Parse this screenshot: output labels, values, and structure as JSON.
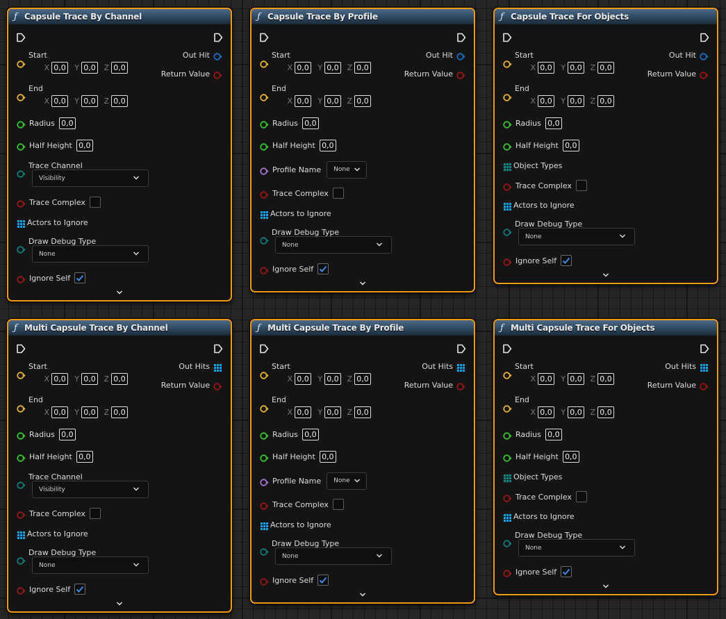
{
  "colors": {
    "accent": "#f09a17",
    "vector_pin": "#e8b332",
    "float_pin": "#36c436",
    "struct_pin": "#0b8d8d",
    "bool_pin": "#9b1515",
    "object_array_pin": "#12a4e8",
    "name_pin": "#a571d1",
    "hit_pin": "#1a6ec5"
  },
  "nodes": [
    {
      "title": "Capsule Trace By Channel",
      "outputs": {
        "hit": "Out Hit",
        "ret": "Return Value"
      },
      "start": "Start",
      "end": "End",
      "axes": {
        "x": "X",
        "y": "Y",
        "z": "Z"
      },
      "start_values": {
        "x": "0,0",
        "y": "0,0",
        "z": "0,0"
      },
      "end_values": {
        "x": "0,0",
        "y": "0,0",
        "z": "0,0"
      },
      "radius": {
        "label": "Radius",
        "value": "0,0"
      },
      "half_height": {
        "label": "Half Height",
        "value": "0,0"
      },
      "trace_channel": {
        "label": "Trace Channel",
        "value": "Visibility"
      },
      "trace_complex": {
        "label": "Trace Complex",
        "checked": false
      },
      "actors_to_ignore": "Actors to Ignore",
      "draw_debug": {
        "label": "Draw Debug Type",
        "value": "None"
      },
      "ignore_self": {
        "label": "Ignore Self",
        "checked": true
      }
    },
    {
      "title": "Capsule Trace By Profile",
      "outputs": {
        "hit": "Out Hit",
        "ret": "Return Value"
      },
      "start": "Start",
      "end": "End",
      "axes": {
        "x": "X",
        "y": "Y",
        "z": "Z"
      },
      "start_values": {
        "x": "0,0",
        "y": "0,0",
        "z": "0,0"
      },
      "end_values": {
        "x": "0,0",
        "y": "0,0",
        "z": "0,0"
      },
      "radius": {
        "label": "Radius",
        "value": "0,0"
      },
      "half_height": {
        "label": "Half Height",
        "value": "0,0"
      },
      "profile_name": {
        "label": "Profile Name",
        "value": "None"
      },
      "trace_complex": {
        "label": "Trace Complex",
        "checked": false
      },
      "actors_to_ignore": "Actors to Ignore",
      "draw_debug": {
        "label": "Draw Debug Type",
        "value": "None"
      },
      "ignore_self": {
        "label": "Ignore Self",
        "checked": true
      }
    },
    {
      "title": "Capsule Trace For Objects",
      "outputs": {
        "hit": "Out Hit",
        "ret": "Return Value"
      },
      "start": "Start",
      "end": "End",
      "axes": {
        "x": "X",
        "y": "Y",
        "z": "Z"
      },
      "start_values": {
        "x": "0,0",
        "y": "0,0",
        "z": "0,0"
      },
      "end_values": {
        "x": "0,0",
        "y": "0,0",
        "z": "0,0"
      },
      "radius": {
        "label": "Radius",
        "value": "0,0"
      },
      "half_height": {
        "label": "Half Height",
        "value": "0,0"
      },
      "object_types": "Object Types",
      "trace_complex": {
        "label": "Trace Complex",
        "checked": false
      },
      "actors_to_ignore": "Actors to Ignore",
      "draw_debug": {
        "label": "Draw Debug Type",
        "value": "None"
      },
      "ignore_self": {
        "label": "Ignore Self",
        "checked": true
      }
    },
    {
      "title": "Multi Capsule Trace By Channel",
      "outputs": {
        "hit": "Out Hits",
        "ret": "Return Value"
      },
      "start": "Start",
      "end": "End",
      "axes": {
        "x": "X",
        "y": "Y",
        "z": "Z"
      },
      "start_values": {
        "x": "0,0",
        "y": "0,0",
        "z": "0,0"
      },
      "end_values": {
        "x": "0,0",
        "y": "0,0",
        "z": "0,0"
      },
      "radius": {
        "label": "Radius",
        "value": "0,0"
      },
      "half_height": {
        "label": "Half Height",
        "value": "0,0"
      },
      "trace_channel": {
        "label": "Trace Channel",
        "value": "Visibility"
      },
      "trace_complex": {
        "label": "Trace Complex",
        "checked": false
      },
      "actors_to_ignore": "Actors to Ignore",
      "draw_debug": {
        "label": "Draw Debug Type",
        "value": "None"
      },
      "ignore_self": {
        "label": "Ignore Self",
        "checked": true
      }
    },
    {
      "title": "Multi Capsule Trace By Profile",
      "outputs": {
        "hit": "Out Hits",
        "ret": "Return Value"
      },
      "start": "Start",
      "end": "End",
      "axes": {
        "x": "X",
        "y": "Y",
        "z": "Z"
      },
      "start_values": {
        "x": "0,0",
        "y": "0,0",
        "z": "0,0"
      },
      "end_values": {
        "x": "0,0",
        "y": "0,0",
        "z": "0,0"
      },
      "radius": {
        "label": "Radius",
        "value": "0,0"
      },
      "half_height": {
        "label": "Half Height",
        "value": "0,0"
      },
      "profile_name": {
        "label": "Profile Name",
        "value": "None"
      },
      "trace_complex": {
        "label": "Trace Complex",
        "checked": false
      },
      "actors_to_ignore": "Actors to Ignore",
      "draw_debug": {
        "label": "Draw Debug Type",
        "value": "None"
      },
      "ignore_self": {
        "label": "Ignore Self",
        "checked": true
      }
    },
    {
      "title": "Multi Capsule Trace For Objects",
      "outputs": {
        "hit": "Out Hits",
        "ret": "Return Value"
      },
      "start": "Start",
      "end": "End",
      "axes": {
        "x": "X",
        "y": "Y",
        "z": "Z"
      },
      "start_values": {
        "x": "0,0",
        "y": "0,0",
        "z": "0,0"
      },
      "end_values": {
        "x": "0,0",
        "y": "0,0",
        "z": "0,0"
      },
      "radius": {
        "label": "Radius",
        "value": "0,0"
      },
      "half_height": {
        "label": "Half Height",
        "value": "0,0"
      },
      "object_types": "Object Types",
      "trace_complex": {
        "label": "Trace Complex",
        "checked": false
      },
      "actors_to_ignore": "Actors to Ignore",
      "draw_debug": {
        "label": "Draw Debug Type",
        "value": "None"
      },
      "ignore_self": {
        "label": "Ignore Self",
        "checked": true
      }
    }
  ]
}
